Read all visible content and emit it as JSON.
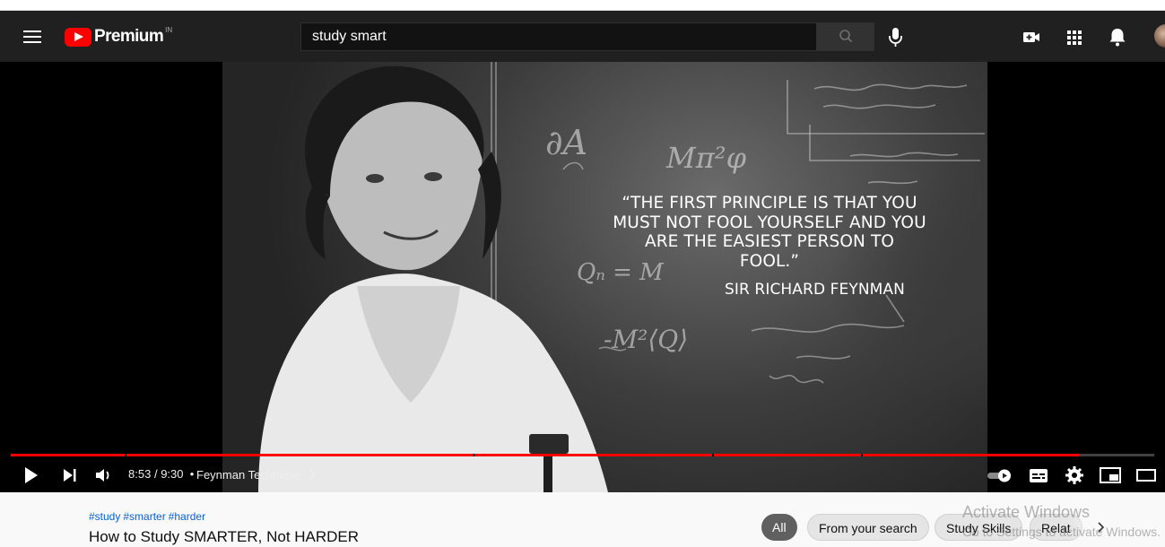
{
  "masthead": {
    "logo_text": "Premium",
    "country_code": "IN",
    "search_value": "study smart"
  },
  "video": {
    "quote": "“THE FIRST PRINCIPLE IS THAT YOU MUST NOT FOOL YOURSELF AND YOU ARE THE EASIEST PERSON TO FOOL.”",
    "author": "SIR RICHARD FEYNMAN",
    "chalk_1": "∂A",
    "chalk_2": "Mπ²φ",
    "chalk_3": "-M²⟨Q⟩",
    "chalk_4": "Qₙ = M"
  },
  "player": {
    "current_time": "8:53",
    "duration": "9:30",
    "time_separator": "/",
    "chapter": "Feynman Technique",
    "progress_fraction": 0.934
  },
  "below": {
    "hashtags": [
      "#study",
      "#smarter",
      "#harder"
    ],
    "title": "How to Study SMARTER, Not HARDER",
    "chips": [
      "All",
      "From your search",
      "Study Skills",
      "Relat"
    ],
    "watermark_line1": "Activate Windows",
    "watermark_line2": "Go to Settings to activate Windows."
  },
  "colors": {
    "brand_red": "#ff0000",
    "masthead_bg": "#202020",
    "link_blue": "#065fd4"
  },
  "icons": [
    "menu-icon",
    "youtube-logo-icon",
    "search-icon",
    "mic-icon",
    "create-video-icon",
    "apps-icon",
    "bell-icon",
    "play-icon",
    "next-icon",
    "volume-icon",
    "autoplay-toggle-icon",
    "captions-icon",
    "settings-icon",
    "miniplayer-icon",
    "theater-icon",
    "chevron-right-icon"
  ]
}
